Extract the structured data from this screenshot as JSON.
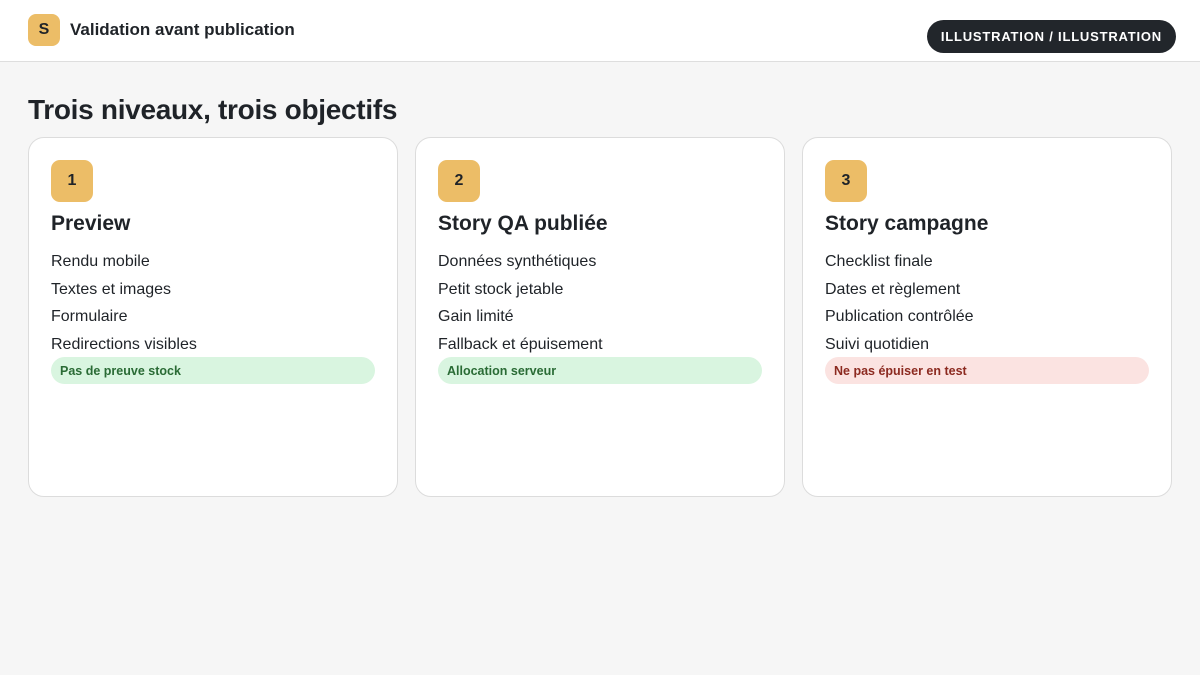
{
  "header": {
    "logo_letter": "S",
    "title": "Validation avant publication",
    "pill": "ILLUSTRATION / ILLUSTRATION"
  },
  "main": {
    "heading": "Trois niveaux, trois objectifs",
    "cards": [
      {
        "number": "1",
        "title": "Preview",
        "items": [
          "Rendu mobile",
          "Textes et images",
          "Formulaire",
          "Redirections visibles"
        ],
        "tag": "Pas de preuve stock",
        "tag_status": "success"
      },
      {
        "number": "2",
        "title": "Story QA publiée",
        "items": [
          "Données synthétiques",
          "Petit stock jetable",
          "Gain limité",
          "Fallback et épuisement"
        ],
        "tag": "Allocation serveur",
        "tag_status": "success"
      },
      {
        "number": "3",
        "title": "Story campagne",
        "items": [
          "Checklist finale",
          "Dates et règlement",
          "Publication contrôlée",
          "Suivi quotidien"
        ],
        "tag": "Ne pas épuiser en test",
        "tag_status": "warning"
      }
    ]
  },
  "colors": {
    "accent": "#ecbd67",
    "dark": "#22262b",
    "success_bg": "#d9f5e0",
    "success_text": "#2a6b35",
    "warning_bg": "#fbe3e1",
    "warning_text": "#8c2a20"
  }
}
